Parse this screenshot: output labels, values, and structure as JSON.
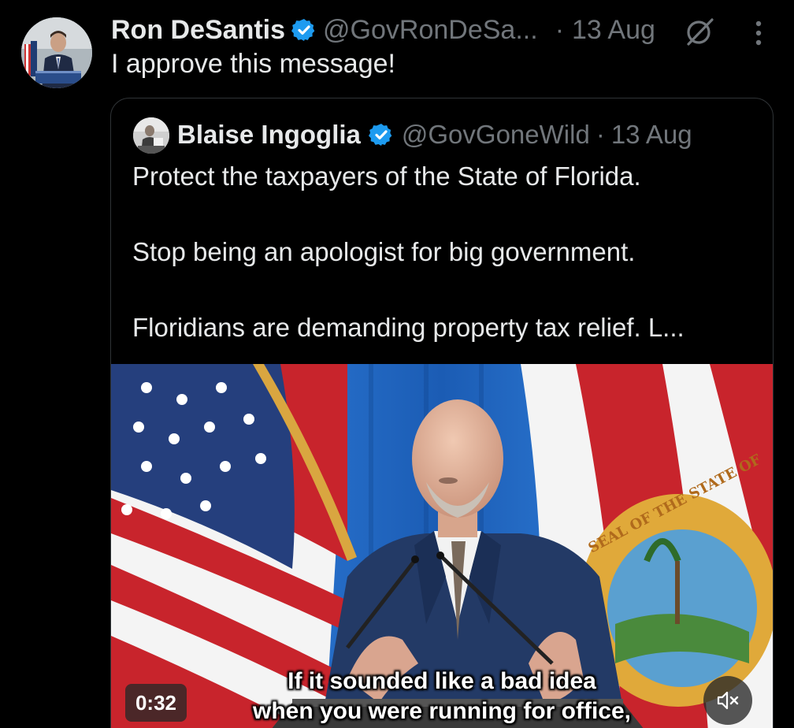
{
  "tweet": {
    "author_name": "Ron DeSantis",
    "author_handle": "@GovRonDeSa...",
    "separator": "·",
    "date": "13 Aug",
    "text": "I approve this message!",
    "icons": {
      "verified": "verified-badge-icon",
      "grok": "grok-icon",
      "more": "more-vertical-icon"
    }
  },
  "quoted_tweet": {
    "author_name": "Blaise Ingoglia",
    "author_handle": "@GovGoneWild",
    "separator": "·",
    "date": "13 Aug",
    "lines": [
      "Protect the taxpayers of the State of Florida.",
      "Stop being an apologist for big government.",
      "Floridians are demanding property tax relief. L..."
    ],
    "video": {
      "duration": "0:32",
      "caption_line_1": "If it sounded like a bad idea",
      "caption_line_2": "when you were running for office,",
      "flag_seal_text": "SEAL OF THE STATE OF",
      "mute_icon": "speaker-muted-icon"
    }
  },
  "colors": {
    "background": "#000000",
    "text_primary": "#e7e9ea",
    "text_secondary": "#71767b",
    "verified_blue": "#1d9bf0",
    "card_border": "#2f3336"
  }
}
